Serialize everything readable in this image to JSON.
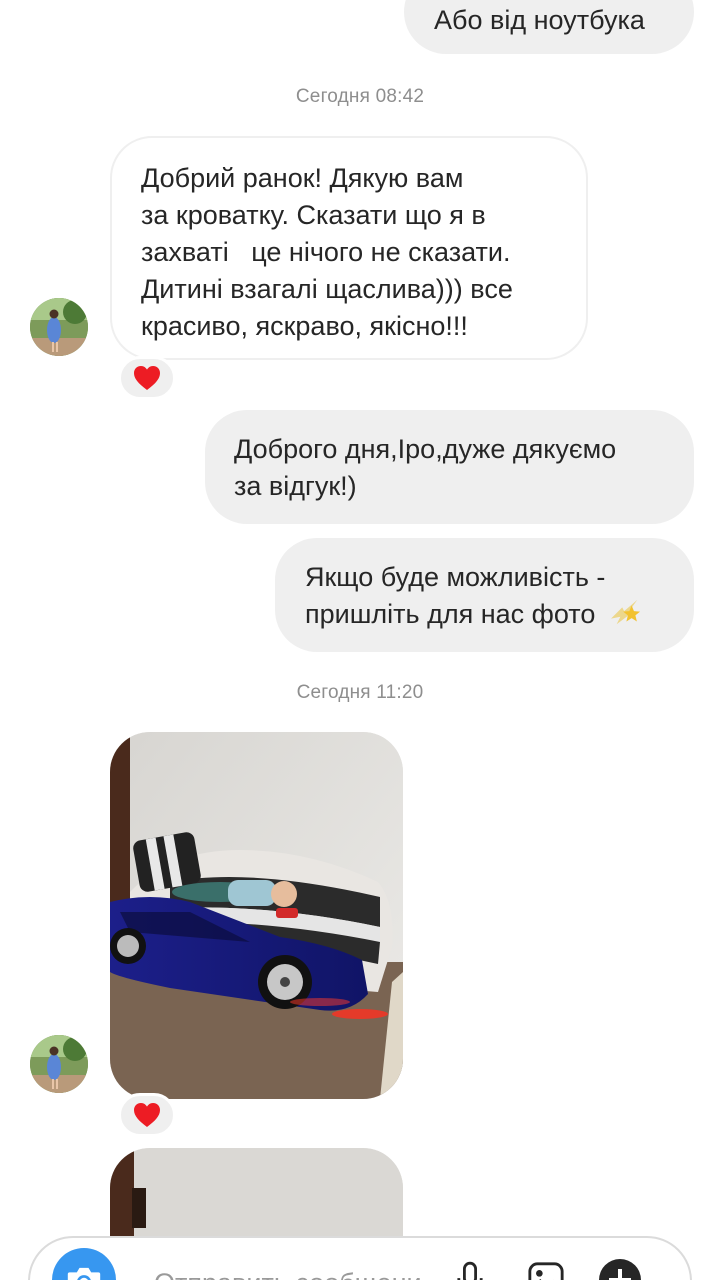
{
  "messages": {
    "top_outgoing": "Або від ноутбука",
    "timestamp_1": "Сегодня 08:42",
    "incoming_1": {
      "lines": [
        "Добрий ранок! Дякую вам",
        "за кроватку. Сказати що я в",
        "захваті   це нічого не сказати.",
        "Дитині взагалі щаслива))) все",
        "красиво, яскраво, якісно!!!"
      ],
      "reaction": "heart-reaction"
    },
    "outgoing_1": {
      "lines": [
        "Доброго дня,Іро,дуже дякуємо",
        "за відгук!)"
      ]
    },
    "outgoing_2": {
      "lines": [
        "Якщо буде можливість -",
        "пришліть для нас фото"
      ],
      "emoji": "shooting-star-emoji"
    },
    "timestamp_2": "Сегодня 11:20",
    "photo_1": {
      "reaction": "heart-reaction"
    }
  },
  "composer": {
    "placeholder": "Отправить сообщени...",
    "icons": [
      "camera-icon",
      "microphone-icon",
      "gallery-icon",
      "plus-icon"
    ]
  },
  "colors": {
    "accent": "#3797f0",
    "outgoing_bubble": "#efefef",
    "incoming_border": "#efefef",
    "timestamp": "#8e8e8e",
    "heart": "#ed1c24"
  }
}
